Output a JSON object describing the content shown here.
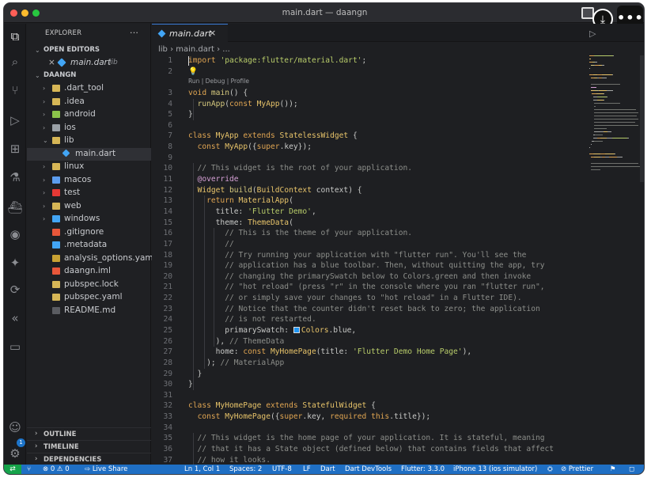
{
  "window": {
    "title": "main.dart — daangn"
  },
  "overlay": {
    "download_glyph": "⤓",
    "more_glyph": "•••"
  },
  "activity_bar": [
    {
      "name": "explorer-icon",
      "glyph": "⧉"
    },
    {
      "name": "search-icon",
      "glyph": "⌕"
    },
    {
      "name": "source-control-icon",
      "glyph": "⑂"
    },
    {
      "name": "run-debug-icon",
      "glyph": "▷"
    },
    {
      "name": "extensions-icon",
      "glyph": "⊞"
    },
    {
      "name": "testing-icon",
      "glyph": "⚗"
    },
    {
      "name": "docker-icon",
      "glyph": "⛴"
    },
    {
      "name": "github-icon",
      "glyph": "◉"
    },
    {
      "name": "python-icon",
      "glyph": "✦"
    },
    {
      "name": "remote-explorer-icon",
      "glyph": "⟳"
    },
    {
      "name": "flutter-icon",
      "glyph": "«"
    },
    {
      "name": "folder-icon",
      "glyph": "▭"
    }
  ],
  "account_badge": "1",
  "sidebar": {
    "title": "EXPLORER",
    "title_more": "···",
    "open_editors_label": "OPEN EDITORS",
    "open_editor": {
      "close": "×",
      "name": "main.dart",
      "folder": "lib"
    },
    "project_label": "DAANGN",
    "tree": [
      {
        "label": ".dart_tool",
        "indent": 1,
        "chev": "›",
        "color": "#d6b656"
      },
      {
        "label": ".idea",
        "indent": 1,
        "chev": "›",
        "color": "#d6b656"
      },
      {
        "label": "android",
        "indent": 1,
        "chev": "›",
        "color": "#8bc34a"
      },
      {
        "label": "ios",
        "indent": 1,
        "chev": "›",
        "color": "#9aa0a6"
      },
      {
        "label": "lib",
        "indent": 1,
        "chev": "⌄",
        "color": "#d6b656"
      },
      {
        "label": "main.dart",
        "indent": 2,
        "chev": "",
        "color": "#42a5f5"
      },
      {
        "label": "linux",
        "indent": 1,
        "chev": "›",
        "color": "#d6b656"
      },
      {
        "label": "macos",
        "indent": 1,
        "chev": "›",
        "color": "#5c9ded"
      },
      {
        "label": "test",
        "indent": 1,
        "chev": "›",
        "color": "#e53935"
      },
      {
        "label": "web",
        "indent": 1,
        "chev": "›",
        "color": "#d6b656"
      },
      {
        "label": "windows",
        "indent": 1,
        "chev": "›",
        "color": "#42a5f5"
      },
      {
        "label": ".gitignore",
        "indent": 1,
        "chev": "",
        "color": "#e8573a"
      },
      {
        "label": ".metadata",
        "indent": 1,
        "chev": "",
        "color": "#42a5f5"
      },
      {
        "label": "analysis_options.yaml",
        "indent": 1,
        "chev": "",
        "color": "#c9a233"
      },
      {
        "label": "daangn.iml",
        "indent": 1,
        "chev": "",
        "color": "#e8573a"
      },
      {
        "label": "pubspec.lock",
        "indent": 1,
        "chev": "",
        "color": "#d6b656"
      },
      {
        "label": "pubspec.yaml",
        "indent": 1,
        "chev": "",
        "color": "#d6b656"
      },
      {
        "label": "README.md",
        "indent": 1,
        "chev": "",
        "color": "#5a5c61"
      }
    ],
    "bottom_sections": [
      "OUTLINE",
      "TIMELINE",
      "DEPENDENCIES"
    ]
  },
  "editor": {
    "tab": {
      "name": "main.dart",
      "close": "×"
    },
    "breadcrumb": "lib  ›  main.dart  ›  ...",
    "codelens": "Run | Debug | Profile",
    "swatch_color": "#2196f3",
    "lines": [
      {
        "n": "1",
        "segs": [
          [
            "k",
            "import "
          ],
          [
            "s",
            "'package:flutter/material.dart'"
          ],
          [
            "p",
            ";"
          ]
        ]
      },
      {
        "n": "2",
        "segs": [
          [
            "t",
            "💡"
          ]
        ]
      },
      {
        "n": "3",
        "segs": [
          [
            "k",
            "void "
          ],
          [
            "f",
            "main"
          ],
          [
            "p",
            "() {"
          ]
        ]
      },
      {
        "n": "4",
        "segs": [
          [
            "p",
            "  "
          ],
          [
            "f",
            "runApp"
          ],
          [
            "p",
            "("
          ],
          [
            "k",
            "const "
          ],
          [
            "t",
            "MyApp"
          ],
          [
            "p",
            "());"
          ]
        ]
      },
      {
        "n": "5",
        "segs": [
          [
            "p",
            "}"
          ]
        ]
      },
      {
        "n": "6",
        "segs": []
      },
      {
        "n": "7",
        "segs": [
          [
            "k",
            "class "
          ],
          [
            "t",
            "MyApp "
          ],
          [
            "k",
            "extends "
          ],
          [
            "t",
            "StatelessWidget "
          ],
          [
            "p",
            "{"
          ]
        ]
      },
      {
        "n": "8",
        "segs": [
          [
            "p",
            "  "
          ],
          [
            "k",
            "const "
          ],
          [
            "t",
            "MyApp"
          ],
          [
            "p",
            "({"
          ],
          [
            "k",
            "super"
          ],
          [
            "p",
            ".key});"
          ]
        ]
      },
      {
        "n": "9",
        "segs": []
      },
      {
        "n": "10",
        "segs": [
          [
            "c",
            "  // This widget is the root of your application."
          ]
        ]
      },
      {
        "n": "11",
        "segs": [
          [
            "a",
            "  @override"
          ]
        ]
      },
      {
        "n": "12",
        "segs": [
          [
            "p",
            "  "
          ],
          [
            "t",
            "Widget "
          ],
          [
            "f",
            "build"
          ],
          [
            "p",
            "("
          ],
          [
            "t",
            "BuildContext "
          ],
          [
            "p",
            "context) {"
          ]
        ]
      },
      {
        "n": "13",
        "segs": [
          [
            "p",
            "    "
          ],
          [
            "k",
            "return "
          ],
          [
            "t",
            "MaterialApp"
          ],
          [
            "p",
            "("
          ]
        ]
      },
      {
        "n": "14",
        "segs": [
          [
            "p",
            "      title: "
          ],
          [
            "s",
            "'Flutter Demo'"
          ],
          [
            "p",
            ","
          ]
        ]
      },
      {
        "n": "15",
        "segs": [
          [
            "p",
            "      theme: "
          ],
          [
            "t",
            "ThemeData"
          ],
          [
            "p",
            "("
          ]
        ]
      },
      {
        "n": "16",
        "segs": [
          [
            "c",
            "        // This is the theme of your application."
          ]
        ]
      },
      {
        "n": "17",
        "segs": [
          [
            "c",
            "        //"
          ]
        ]
      },
      {
        "n": "18",
        "segs": [
          [
            "c",
            "        // Try running your application with \"flutter run\". You'll see the"
          ]
        ]
      },
      {
        "n": "19",
        "segs": [
          [
            "c",
            "        // application has a blue toolbar. Then, without quitting the app, try"
          ]
        ]
      },
      {
        "n": "20",
        "segs": [
          [
            "c",
            "        // changing the primarySwatch below to Colors.green and then invoke"
          ]
        ]
      },
      {
        "n": "21",
        "segs": [
          [
            "c",
            "        // \"hot reload\" (press \"r\" in the console where you ran \"flutter run\","
          ]
        ]
      },
      {
        "n": "22",
        "segs": [
          [
            "c",
            "        // or simply save your changes to \"hot reload\" in a Flutter IDE)."
          ]
        ]
      },
      {
        "n": "23",
        "segs": [
          [
            "c",
            "        // Notice that the counter didn't reset back to zero; the application"
          ]
        ]
      },
      {
        "n": "24",
        "segs": [
          [
            "c",
            "        // is not restarted."
          ]
        ]
      },
      {
        "n": "25",
        "segs": [
          [
            "p",
            "        primarySwatch: "
          ],
          [
            "sw",
            ""
          ],
          [
            "t",
            "Colors"
          ],
          [
            "p",
            "."
          ],
          [
            "p",
            "blue,"
          ]
        ]
      },
      {
        "n": "26",
        "segs": [
          [
            "p",
            "      ), "
          ],
          [
            "c",
            "// ThemeData"
          ]
        ]
      },
      {
        "n": "27",
        "segs": [
          [
            "p",
            "      home: "
          ],
          [
            "k",
            "const "
          ],
          [
            "t",
            "MyHomePage"
          ],
          [
            "p",
            "(title: "
          ],
          [
            "s",
            "'Flutter Demo Home Page'"
          ],
          [
            "p",
            "),"
          ]
        ]
      },
      {
        "n": "28",
        "segs": [
          [
            "p",
            "    ); "
          ],
          [
            "c",
            "// MaterialApp"
          ]
        ]
      },
      {
        "n": "29",
        "segs": [
          [
            "p",
            "  }"
          ]
        ]
      },
      {
        "n": "30",
        "segs": [
          [
            "p",
            "}"
          ]
        ]
      },
      {
        "n": "31",
        "segs": []
      },
      {
        "n": "32",
        "segs": [
          [
            "k",
            "class "
          ],
          [
            "t",
            "MyHomePage "
          ],
          [
            "k",
            "extends "
          ],
          [
            "t",
            "StatefulWidget "
          ],
          [
            "p",
            "{"
          ]
        ]
      },
      {
        "n": "33",
        "segs": [
          [
            "p",
            "  "
          ],
          [
            "k",
            "const "
          ],
          [
            "t",
            "MyHomePage"
          ],
          [
            "p",
            "({"
          ],
          [
            "k",
            "super"
          ],
          [
            "p",
            ".key, "
          ],
          [
            "k",
            "required this"
          ],
          [
            "p",
            ".title});"
          ]
        ]
      },
      {
        "n": "34",
        "segs": []
      },
      {
        "n": "35",
        "segs": [
          [
            "c",
            "  // This widget is the home page of your application. It is stateful, meaning"
          ]
        ]
      },
      {
        "n": "36",
        "segs": [
          [
            "c",
            "  // that it has a State object (defined below) that contains fields that affect"
          ]
        ]
      },
      {
        "n": "37",
        "segs": [
          [
            "c",
            "  // how it looks."
          ]
        ]
      }
    ]
  },
  "status_bar": {
    "remote": "⇄",
    "problems": "⊗ 0 ⚠ 0",
    "live_share": "⇨ Live Share",
    "position": "Ln 1, Col 1",
    "spaces": "Spaces: 2",
    "encoding": "UTF-8",
    "eol": "LF",
    "language": "Dart",
    "devtools": "Dart DevTools",
    "flutter": "Flutter: 3.3.0",
    "device": "iPhone 13 (ios simulator)",
    "prettier": "⊘ Prettier",
    "bell": "🔔"
  },
  "colors": {
    "accent": "#1f6fc4",
    "remote": "#16a34a",
    "background": "#1e1f22"
  }
}
